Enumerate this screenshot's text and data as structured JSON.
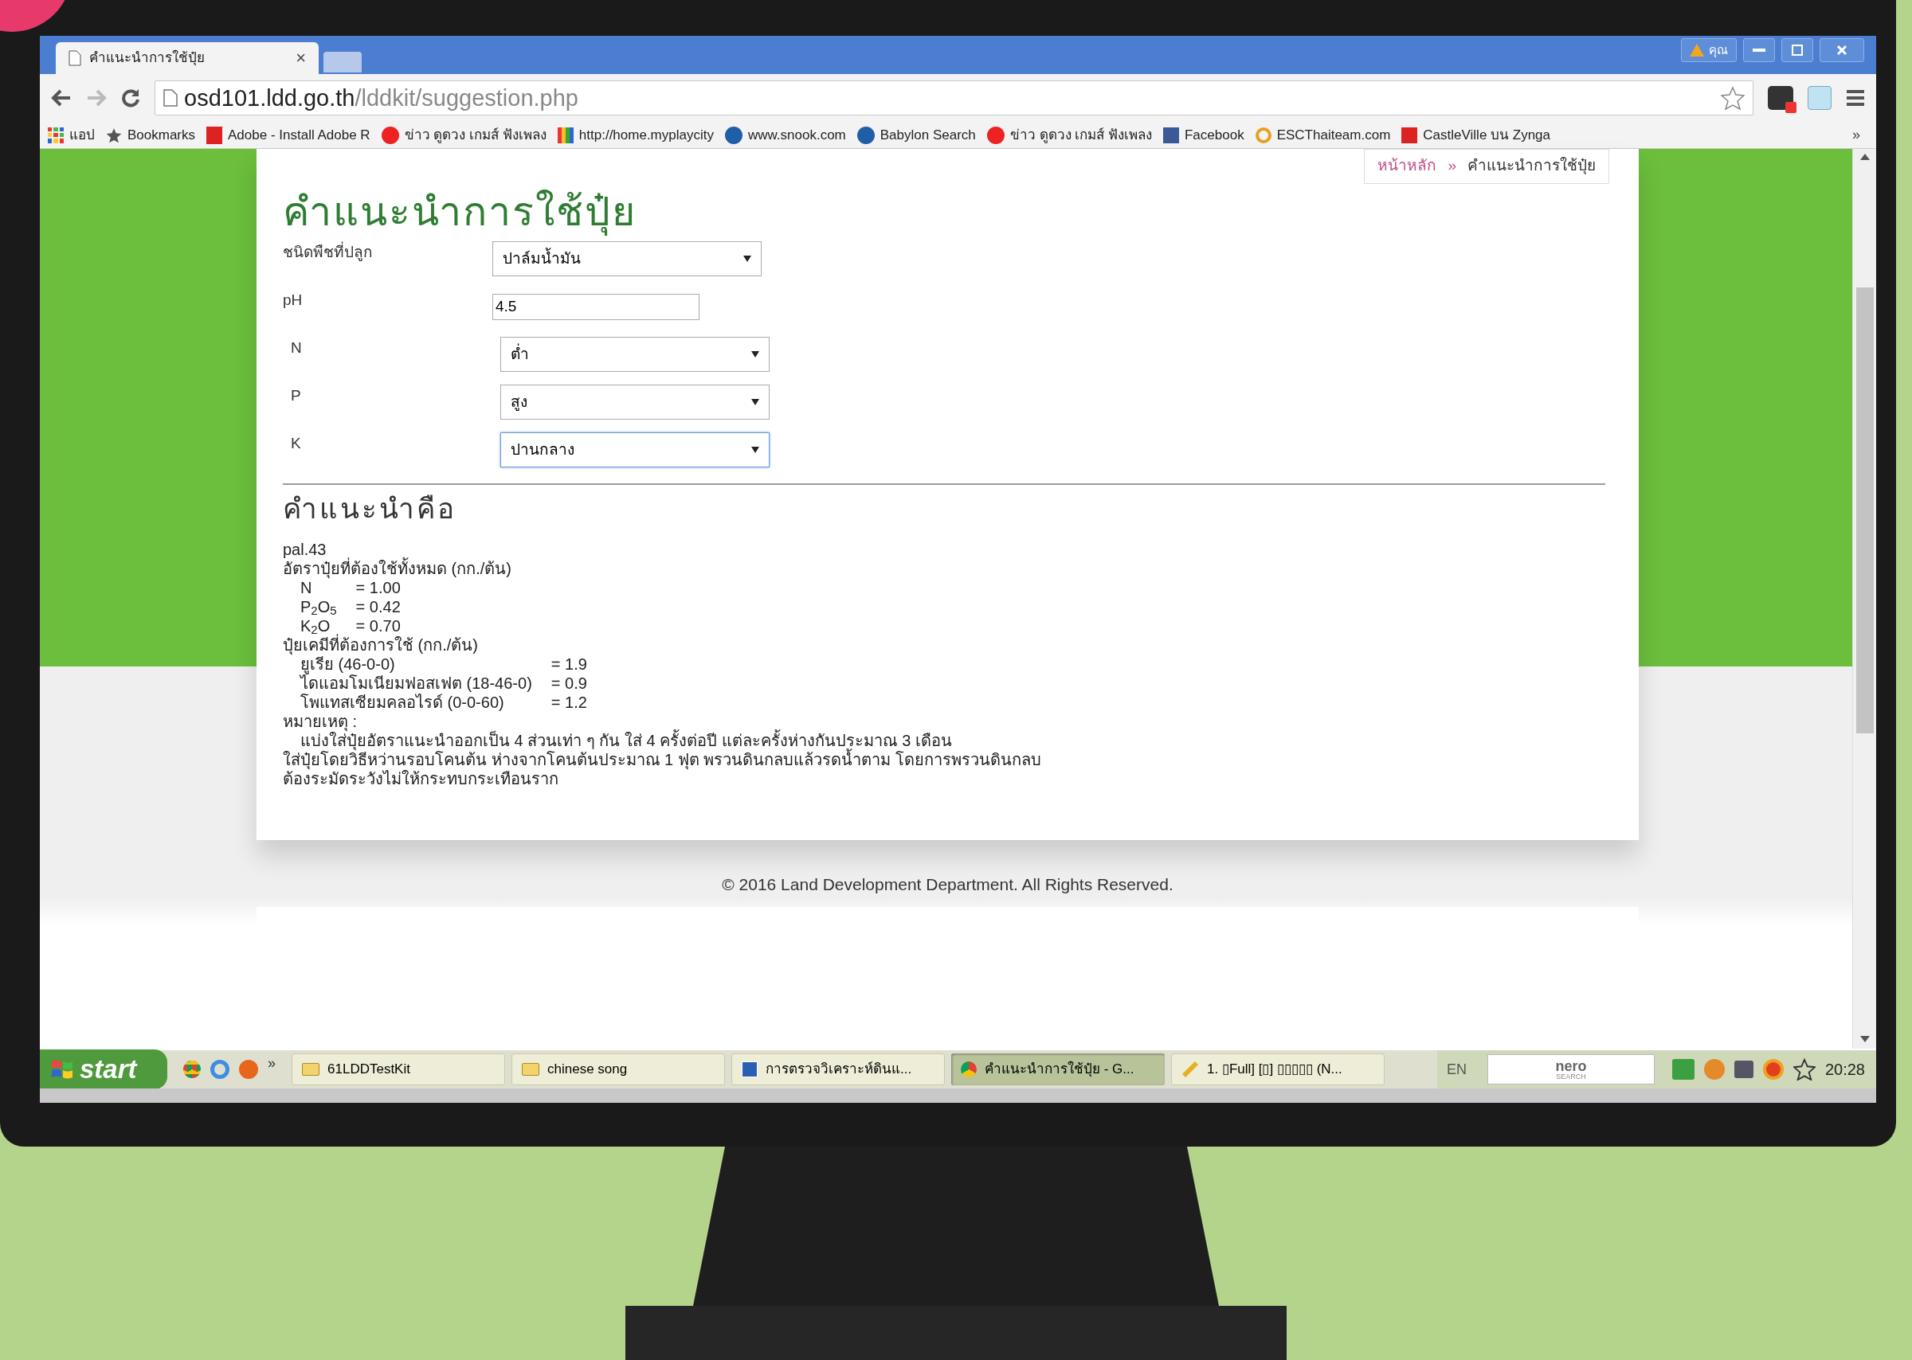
{
  "browser": {
    "tab": {
      "title": "คำแนะนำการใช้ปุ๋ย",
      "close": "×"
    },
    "profile": "คุณ",
    "address": {
      "host": "osd101.ldd.go.th",
      "path": "/lddkit/suggestion.php"
    },
    "bookmarks": [
      {
        "label": "แอป",
        "kind": "apps"
      },
      {
        "label": "Bookmarks",
        "kind": "star"
      },
      {
        "label": "Adobe - Install Adobe R",
        "kind": "adobe"
      },
      {
        "label": "ข่าว ดูดวง เกมส์ ฟังเพลง",
        "kind": "sanook"
      },
      {
        "label": "http://home.myplaycity",
        "kind": "bars"
      },
      {
        "label": "www.snook.com",
        "kind": "babylon"
      },
      {
        "label": "Babylon Search",
        "kind": "babylon"
      },
      {
        "label": "ข่าว ดูดวง เกมส์ ฟังเพลง",
        "kind": "sanook"
      },
      {
        "label": "Facebook",
        "kind": "facebook"
      },
      {
        "label": "ESCThaiteam.com",
        "kind": "esc"
      },
      {
        "label": "CastleVille บน Zynga",
        "kind": "castle"
      }
    ],
    "bookmarks_more": "»"
  },
  "page": {
    "breadcrumb": [
      {
        "label": "หน้าหลัก",
        "selected": false
      },
      {
        "label": "»",
        "selected": false
      },
      {
        "label": "คำแนะนำการใช้ปุ๋ย",
        "selected": true
      }
    ],
    "title": "คำแนะนำการใช้ปุ๋ย",
    "fields": [
      {
        "kind": "select",
        "label": "ชนิดพืชที่ปลูก",
        "value": "ปาล์มน้ำมัน"
      },
      {
        "kind": "input",
        "label": "pH",
        "value": "4.5"
      },
      {
        "kind": "select",
        "label": "N",
        "value": "ต่ำ"
      },
      {
        "kind": "select",
        "label": "P",
        "value": "สูง"
      },
      {
        "kind": "select",
        "label": "K",
        "value": "ปานกลาง",
        "focused": true
      }
    ],
    "result": {
      "heading": "คำแนะนำคือ",
      "blocks": [
        {
          "text": "pal.43"
        },
        {
          "text": "อัตราปุ๋ยที่ต้องใช้ทั้งหมด (กก./ต้น)",
          "children": [
            {
              "label": "N",
              "value": "= 1.00"
            },
            {
              "label": "P$_{2}$O$_{5}$",
              "value": "= 0.42"
            },
            {
              "label": "K$_{2}$O",
              "value": "= 0.70"
            }
          ]
        },
        {
          "text": "ปุ๋ยเคมีที่ต้องการใช้ (กก./ต้น)",
          "children": [
            {
              "label": "ยูเรีย (46-0-0)",
              "value": "= 1.9"
            },
            {
              "label": "ไดแอมโมเนียมฟอสเฟต (18-46-0)",
              "value": "= 0.9"
            },
            {
              "label": "โพแทสเซียมคลอไรด์ (0-0-60)",
              "value": "= 1.2"
            }
          ]
        },
        {
          "text": "หมายเหตุ :",
          "children": [
            {
              "label": "แบ่งใส่ปุ๋ยอัตราแนะนำออกเป็น 4 ส่วนเท่า ๆ กัน ใส่ 4 ครั้งต่อปี  แต่ละครั้งห่างกันประมาณ 3 เดือน"
            }
          ]
        },
        {
          "text": "ใส่ปุ๋ยโดยวิธีหว่านรอบโคนต้น  ห่างจากโคนต้นประมาณ 1 ฟุต  พรวนดินกลบแล้วรดน้ำตาม โดยการพรวนดินกลบ"
        },
        {
          "text": "ต้องระมัดระวังไม่ให้กระทบกระเทือนราก"
        }
      ]
    },
    "footer": "© 2016 Land Development Department. All Rights Reserved."
  },
  "taskbar": {
    "start": "start",
    "quick_more": "»",
    "items": [
      {
        "label": "61LDDTestKit",
        "kind": "folder",
        "selected": false
      },
      {
        "label": "chinese song",
        "kind": "folder",
        "selected": false
      },
      {
        "label": "การตรวจวิเคราะห์ดินแ...",
        "kind": "doc",
        "selected": false
      },
      {
        "label": "คำแนะนำการใช้ปุ๋ย - G...",
        "kind": "chrome",
        "selected": true
      },
      {
        "label": "1. ▯Full] [▯] ▯▯▯▯▯ (N...",
        "kind": "pencil",
        "selected": false
      }
    ],
    "language": "EN",
    "search": "nero",
    "search_sub": "SEARCH",
    "time": "20:28"
  }
}
